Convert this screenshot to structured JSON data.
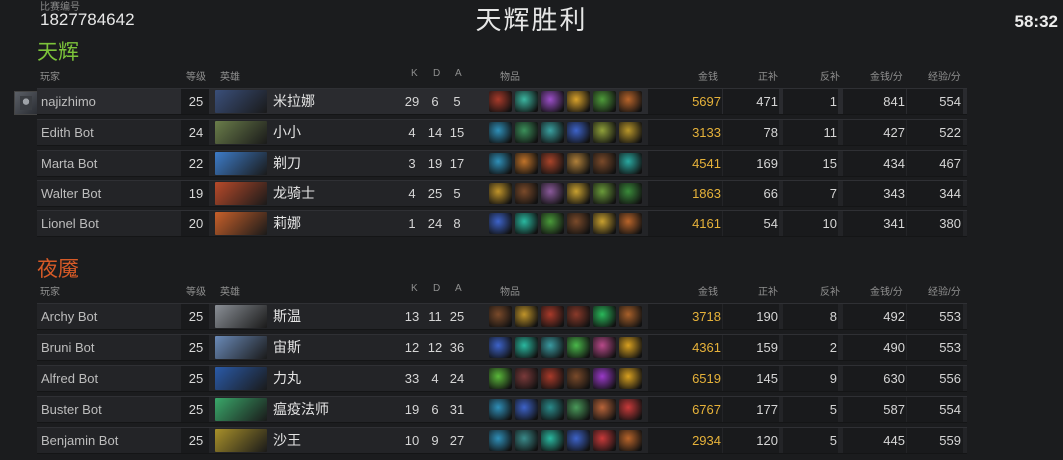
{
  "header": {
    "match_label": "比赛编号",
    "match_id": "1827784642",
    "result": "天辉胜利",
    "timer": "58:32"
  },
  "columns": {
    "player": "玩家",
    "level": "等级",
    "hero": "英雄",
    "k": "K",
    "d": "D",
    "a": "A",
    "items": "物品",
    "gold": "金钱",
    "last_hits": "正补",
    "denies": "反补",
    "gpm": "金钱/分",
    "xpm": "经验/分"
  },
  "teams": [
    {
      "name": "天辉",
      "color": "#7cc33a",
      "players": [
        {
          "name": "najizhimo",
          "level": "25",
          "hero": "米拉娜",
          "k": "29",
          "d": "6",
          "a": "5",
          "gold": "5697",
          "lh": "471",
          "dn": "1",
          "gpm": "841",
          "xpm": "554",
          "portrait": "#3a4f7a",
          "items": [
            "#a83a2a",
            "#3bb5a0",
            "#9b4fc8",
            "#d9a22b",
            "#4e9b3a",
            "#b8642a"
          ]
        },
        {
          "name": "Edith Bot",
          "level": "24",
          "hero": "小小",
          "k": "4",
          "d": "14",
          "a": "15",
          "gold": "3133",
          "lh": "78",
          "dn": "11",
          "gpm": "427",
          "xpm": "522",
          "portrait": "#6a7d4a",
          "items": [
            "#2f8fb8",
            "#3b8f5a",
            "#3aa0a0",
            "#3d63c9",
            "#8fa03a",
            "#b8962a"
          ]
        },
        {
          "name": "Marta Bot",
          "level": "22",
          "hero": "剃刀",
          "k": "3",
          "d": "19",
          "a": "17",
          "gold": "4541",
          "lh": "169",
          "dn": "15",
          "gpm": "434",
          "xpm": "467",
          "portrait": "#3d7cc9",
          "items": [
            "#2f8fb8",
            "#c0732a",
            "#a8442a",
            "#b0803a",
            "#7a4a2a",
            "#2aa8a0"
          ]
        },
        {
          "name": "Walter Bot",
          "level": "19",
          "hero": "龙骑士",
          "k": "4",
          "d": "25",
          "a": "5",
          "gold": "1863",
          "lh": "66",
          "dn": "7",
          "gpm": "343",
          "xpm": "344",
          "portrait": "#b84a2a",
          "items": [
            "#c0942a",
            "#7a4a2a",
            "#8a5a9a",
            "#c8a030",
            "#6a9a3a",
            "#3a8a3a"
          ]
        },
        {
          "name": "Lionel Bot",
          "level": "20",
          "hero": "莉娜",
          "k": "1",
          "d": "24",
          "a": "8",
          "gold": "4161",
          "lh": "54",
          "dn": "10",
          "gpm": "341",
          "xpm": "380",
          "portrait": "#c8602a",
          "items": [
            "#3d63c9",
            "#2ab8a0",
            "#4a9a3a",
            "#7a4a2a",
            "#c8a030",
            "#b8642a"
          ]
        }
      ]
    },
    {
      "name": "夜魇",
      "color": "#d65a27",
      "players": [
        {
          "name": "Archy Bot",
          "level": "25",
          "hero": "斯温",
          "k": "13",
          "d": "11",
          "a": "25",
          "gold": "3718",
          "lh": "190",
          "dn": "8",
          "gpm": "492",
          "xpm": "553",
          "portrait": "#8a8f96",
          "items": [
            "#7a4a2a",
            "#c0942a",
            "#a83a2a",
            "#8a3a2a",
            "#2ab85a",
            "#a8602a"
          ]
        },
        {
          "name": "Bruni Bot",
          "level": "25",
          "hero": "宙斯",
          "k": "12",
          "d": "12",
          "a": "36",
          "gold": "4361",
          "lh": "159",
          "dn": "2",
          "gpm": "490",
          "xpm": "553",
          "portrait": "#6a8ab8",
          "items": [
            "#3d63c9",
            "#2ab8a0",
            "#3a9aa0",
            "#4ab84a",
            "#b84a8a",
            "#d8a020"
          ]
        },
        {
          "name": "Alfred Bot",
          "level": "25",
          "hero": "力丸",
          "k": "33",
          "d": "4",
          "a": "24",
          "gold": "6519",
          "lh": "145",
          "dn": "9",
          "gpm": "630",
          "xpm": "556",
          "portrait": "#2a5aa8",
          "items": [
            "#5ab83a",
            "#7a3a3a",
            "#a83a2a",
            "#7a4a2a",
            "#9a3ac8",
            "#d8a020"
          ]
        },
        {
          "name": "Buster Bot",
          "level": "25",
          "hero": "瘟疫法师",
          "k": "19",
          "d": "6",
          "a": "31",
          "gold": "6767",
          "lh": "177",
          "dn": "5",
          "gpm": "587",
          "xpm": "554",
          "portrait": "#3aa86a",
          "items": [
            "#2f8fb8",
            "#3d63c9",
            "#2a8a8a",
            "#4a9a5a",
            "#b8643a",
            "#c83a3a"
          ]
        },
        {
          "name": "Benjamin Bot",
          "level": "25",
          "hero": "沙王",
          "k": "10",
          "d": "9",
          "a": "27",
          "gold": "2934",
          "lh": "120",
          "dn": "5",
          "gpm": "445",
          "xpm": "559",
          "portrait": "#a8902a",
          "items": [
            "#2f8fb8",
            "#3a8a8a",
            "#2ab8a0",
            "#3d63c9",
            "#c83a3a",
            "#b8642a"
          ]
        }
      ]
    }
  ]
}
